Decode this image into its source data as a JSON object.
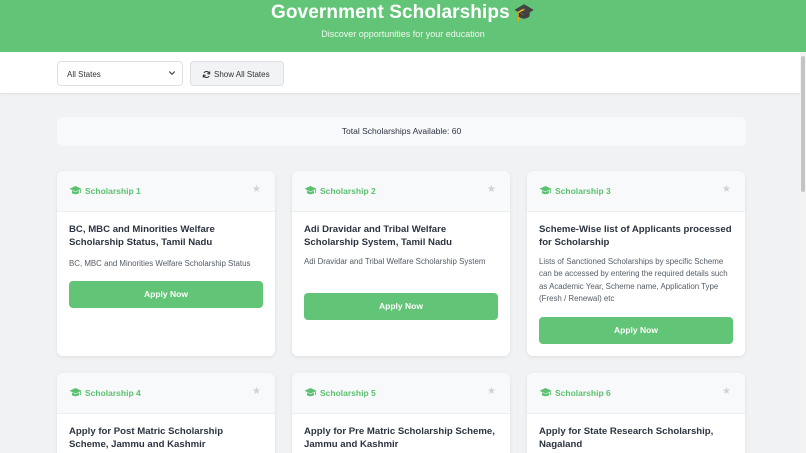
{
  "header": {
    "title": "Government Scholarships",
    "subtitle": "Discover opportunities for your education",
    "title_icon": "graduation-cap-icon"
  },
  "toolbar": {
    "state_select_value": "All States",
    "show_all_label": "Show All States"
  },
  "summary": {
    "total_label": "Total Scholarships Available: 60"
  },
  "colors": {
    "brand_green": "#62c476",
    "page_bg": "#f1f2f4"
  },
  "cards": [
    {
      "number_label": "Scholarship 1",
      "title": "BC, MBC and Minorities Welfare Scholarship Status, Tamil Nadu",
      "description": "BC, MBC and Minorities Welfare Scholarship Status",
      "button_label": "Apply Now"
    },
    {
      "number_label": "Scholarship 2",
      "title": "Adi Dravidar and Tribal Welfare Scholarship System, Tamil Nadu",
      "description": "Adi Dravidar and Tribal Welfare Scholarship System",
      "button_label": "Apply Now"
    },
    {
      "number_label": "Scholarship 3",
      "title": "Scheme-Wise list of Applicants processed for Scholarship",
      "description": "Lists of Sanctioned Scholarships by specific Scheme can be accessed by entering the required details such as Academic Year, Scheme name, Application Type (Fresh / Renewal) etc",
      "button_label": "Apply Now"
    },
    {
      "number_label": "Scholarship 4",
      "title": "Apply for Post Matric Scholarship Scheme, Jammu and Kashmir"
    },
    {
      "number_label": "Scholarship 5",
      "title": "Apply for Pre Matric Scholarship Scheme, Jammu and Kashmir"
    },
    {
      "number_label": "Scholarship 6",
      "title": "Apply for State Research Scholarship, Nagaland"
    }
  ]
}
